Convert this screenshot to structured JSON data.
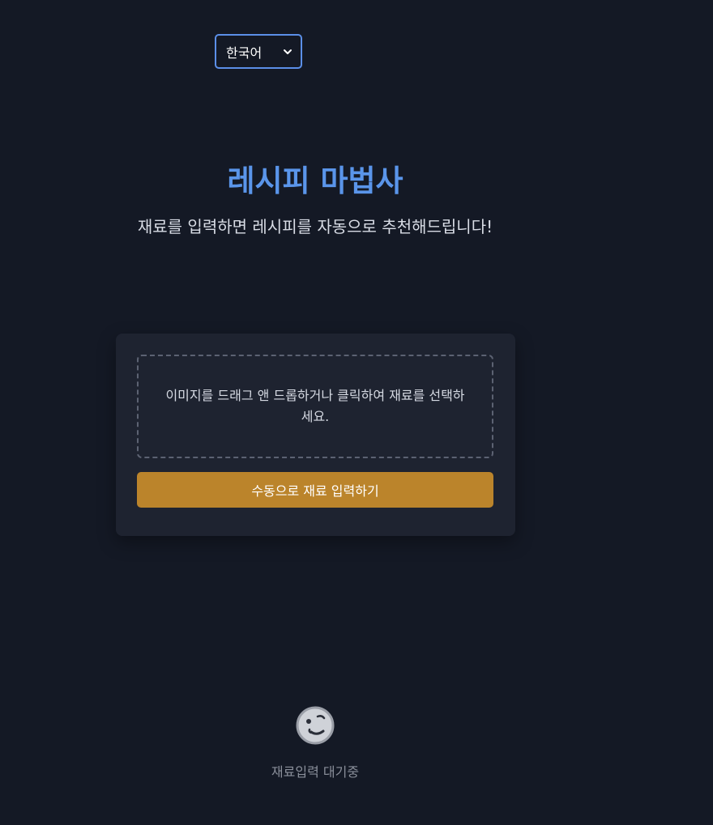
{
  "language_select": {
    "selected": "한국어",
    "icon": "chevron-down-icon"
  },
  "header": {
    "title": "레시피 마법사",
    "subtitle": "재료를 입력하면 레시피를 자동으로 추천해드립니다!"
  },
  "upload_card": {
    "dropzone_text": "이미지를 드래그 앤 드롭하거나 클릭하여 재료를 선택하세요.",
    "manual_button_label": "수동으로 재료 입력하기"
  },
  "status": {
    "icon": "waiting-face-icon",
    "text": "재료입력 대기중"
  },
  "colors": {
    "background": "#141925",
    "card": "#1e2330",
    "accent_blue": "#5a95ea",
    "button_gold": "#bb842b"
  }
}
